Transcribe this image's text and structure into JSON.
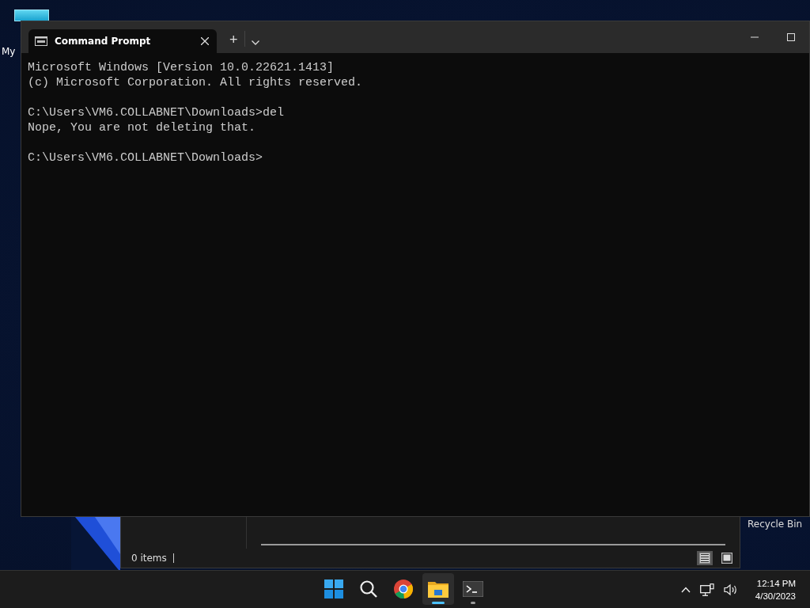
{
  "desktop_icons": [
    {
      "label": "My"
    },
    {
      "label": "Recycle Bin"
    }
  ],
  "explorer_window": {
    "status_text": "0 items",
    "view_buttons": [
      {
        "kind": "details",
        "selected": true
      },
      {
        "kind": "large-icons",
        "selected": false
      }
    ]
  },
  "terminal_window": {
    "tab": {
      "title": "Command Prompt"
    },
    "new_tab": "+",
    "output": [
      [
        "Microsoft Windows [Version 10.0.22621.1413]",
        "(c) Microsoft Corporation. All rights reserved."
      ],
      [
        "C:\\Users\\VM6.COLLABNET\\Downloads>del",
        "Nope, You are not deleting that."
      ],
      [
        "C:\\Users\\VM6.COLLABNET\\Downloads>"
      ]
    ]
  },
  "taskbar": {
    "apps": [
      {
        "kind": "start",
        "open": false,
        "active": false
      },
      {
        "kind": "search",
        "open": false,
        "active": false
      },
      {
        "kind": "browser",
        "open": false,
        "active": false
      },
      {
        "kind": "folder",
        "open": true,
        "active": true
      },
      {
        "kind": "terminal",
        "open": true,
        "active": false
      }
    ],
    "clock": {
      "time": "12:14 PM",
      "date": "4/30/2023"
    }
  }
}
